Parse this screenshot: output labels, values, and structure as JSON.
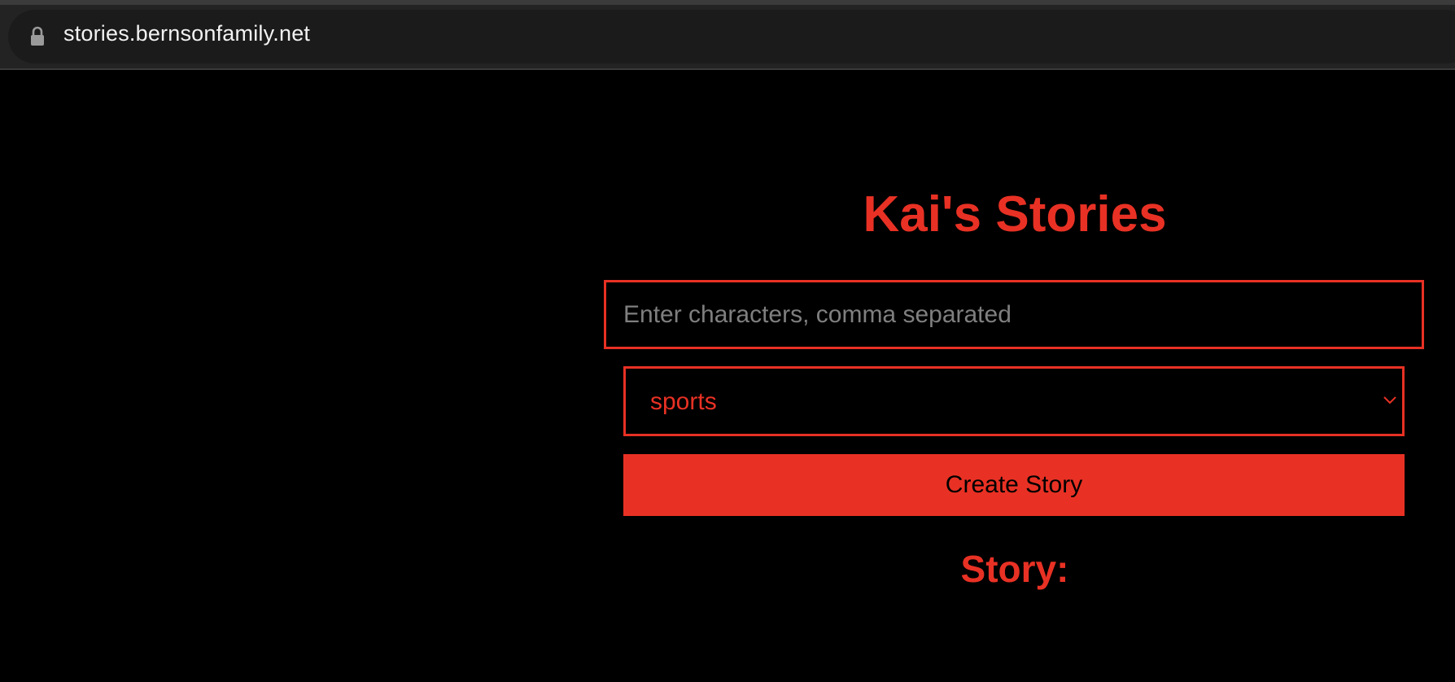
{
  "browser": {
    "url": "stories.bernsonfamily.net",
    "lock_icon": "lock-icon"
  },
  "page": {
    "title": "Kai's Stories",
    "characters_input": {
      "value": "",
      "placeholder": "Enter characters, comma separated"
    },
    "genre_select": {
      "selected": "sports",
      "icon": "chevron-down-icon"
    },
    "create_button_label": "Create Story",
    "story_heading": "Story:"
  },
  "colors": {
    "accent": "#e83124",
    "background": "#000000",
    "placeholder": "#7f7f7f",
    "browser_chrome": "#232323"
  }
}
